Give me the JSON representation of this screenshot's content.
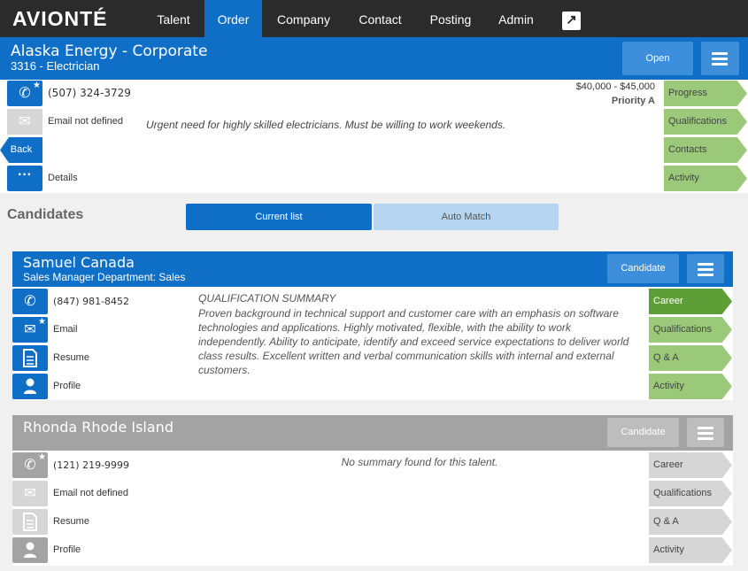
{
  "app": {
    "logo": "AVIONTÉ"
  },
  "nav": {
    "items": [
      "Talent",
      "Order",
      "Company",
      "Contact",
      "Posting",
      "Admin"
    ],
    "active": "Order"
  },
  "order": {
    "title": "Alaska Energy - Corporate",
    "subtitle": "3316 - Electrician",
    "status_button": "Open",
    "phone": "(507) 324-3729",
    "email": "Email not defined",
    "back": "Back",
    "details": "Details",
    "pay_range": "$40,000 - $45,000",
    "priority": "Priority A",
    "description": "Urgent need for highly skilled electricians. Must be willing to work weekends.",
    "side_tabs": [
      "Progress",
      "Qualifications",
      "Contacts",
      "Activity"
    ]
  },
  "candidates": {
    "heading": "Candidates",
    "tabs": [
      "Current list",
      "Auto Match"
    ],
    "list": [
      {
        "name": "Samuel Canada",
        "subtitle": "Sales Manager Department: Sales",
        "button": "Candidate",
        "phone": "(847) 981-8452",
        "email": "Email",
        "resume": "Resume",
        "profile": "Profile",
        "summary_title": "QUALIFICATION SUMMARY",
        "summary": "Proven background in technical support and customer care with an emphasis on software technologies and applications. Highly motivated, flexible, with the ability to work independently. Ability to anticipate, identify and exceed service expectations to deliver world class results. Excellent written and verbal communication skills with internal and external customers.",
        "side_tabs": [
          "Career",
          "Qualifications",
          "Q & A",
          "Activity"
        ]
      },
      {
        "name": "Rhonda Rhode Island",
        "button": "Candidate",
        "phone": "(121) 219-9999",
        "email": "Email not defined",
        "resume": "Resume",
        "profile": "Profile",
        "summary": "No summary found for this talent.",
        "side_tabs": [
          "Career",
          "Qualifications",
          "Q & A",
          "Activity"
        ]
      }
    ]
  },
  "colors": {
    "primary": "#0f6fc6",
    "topbar": "#2b2b2b",
    "green": "#9bc97a",
    "green_dark": "#5e9e36",
    "grey_header": "#a3a3a3"
  }
}
